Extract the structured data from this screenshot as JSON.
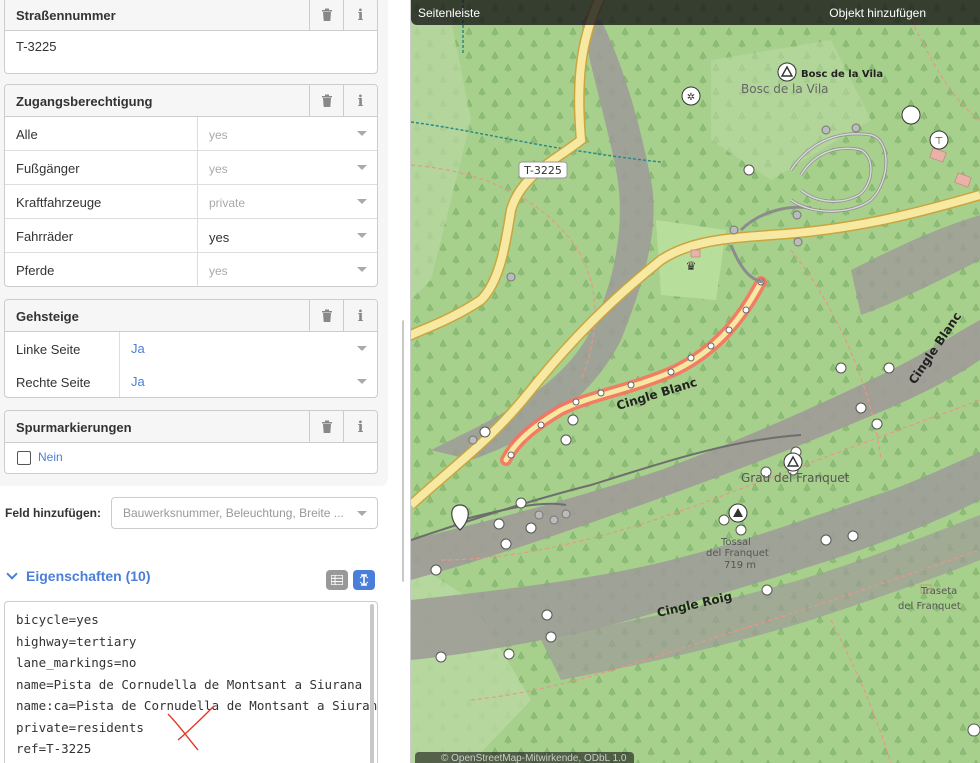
{
  "fields": {
    "street_number": {
      "title": "Straßennummer",
      "value": "T-3225"
    },
    "access": {
      "title": "Zugangsberechtigung",
      "rows": [
        {
          "label": "Alle",
          "value": "yes",
          "state": "placeholder"
        },
        {
          "label": "Fußgänger",
          "value": "yes",
          "state": "placeholder"
        },
        {
          "label": "Kraftfahrzeuge",
          "value": "private",
          "state": "placeholder"
        },
        {
          "label": "Fahrräder",
          "value": "yes",
          "state": "set"
        },
        {
          "label": "Pferde",
          "value": "yes",
          "state": "placeholder"
        }
      ]
    },
    "sidewalks": {
      "title": "Gehsteige",
      "rows": [
        {
          "label": "Linke Seite",
          "value": "Ja"
        },
        {
          "label": "Rechte Seite",
          "value": "Ja"
        }
      ]
    },
    "lane_markings": {
      "title": "Spurmarkierungen",
      "checkbox_label": "Nein",
      "checked": false
    }
  },
  "add_field": {
    "label": "Feld hinzufügen:",
    "placeholder": "Bauwerksnummer, Beleuchtung, Breite ..."
  },
  "tags": {
    "heading": "Eigenschaften (10)",
    "lines": [
      "bicycle=yes",
      "highway=tertiary",
      "lane_markings=no",
      "name=Pista de Cornudella de Montsant a Siurana",
      "name:ca=Pista de Cornudella de Montsant a Siurana",
      "private=residents",
      "ref=T-3225"
    ]
  },
  "map": {
    "toolbar": {
      "sidebar_toggle": "Seitenleiste",
      "add_feature": "Objekt hinzufügen"
    },
    "labels": {
      "bosc_title": "Bosc de la Vila",
      "bosc_area": "Bosc de la Vila",
      "road_ref": "T-3225",
      "cingle_blanc_1": "Cingle Blanc",
      "cingle_blanc_2": "Cingle Blanc",
      "grau": "Grau del Franquet",
      "tossal_1": "Tossal",
      "tossal_2": "del Franquet",
      "tossal_ele": "719 m",
      "cingle_roig": "Cingle Roig",
      "traseta_1": "Traseta",
      "traseta_2": "del Franquet"
    },
    "attribution": "© OpenStreetMap-Mitwirkende, ODbL 1.0",
    "colors": {
      "forest": "#a8d08d",
      "rock": "#9a9694",
      "road": "#f7e9a2",
      "selected": "#ff6f5e",
      "footpath": "#e8968a"
    }
  }
}
